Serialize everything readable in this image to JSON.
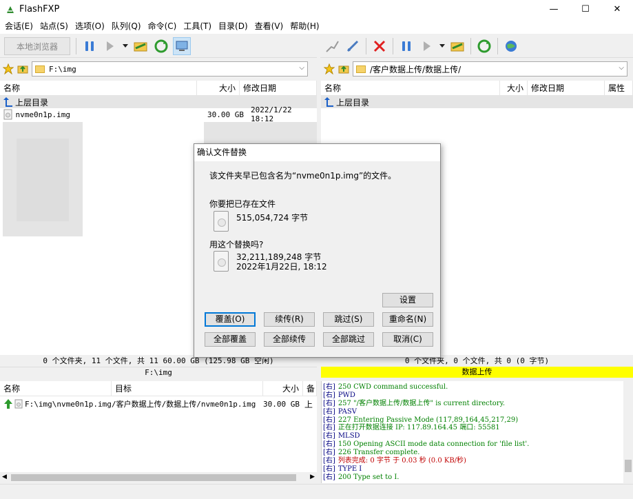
{
  "window": {
    "title": "FlashFXP",
    "minimize": "—",
    "maximize": "☐",
    "close": "✕"
  },
  "menu": [
    "会话(E)",
    "站点(S)",
    "选项(O)",
    "队列(Q)",
    "命令(C)",
    "工具(T)",
    "目录(D)",
    "查看(V)",
    "帮助(H)"
  ],
  "left_toolbar": {
    "local_browse": "本地浏览器"
  },
  "left_address": {
    "path": "F:\\img"
  },
  "right_address": {
    "path": "/客户数据上传/数据上传/"
  },
  "left_pane": {
    "columns": {
      "name": "名称",
      "size": "大小",
      "modified": "修改日期"
    },
    "parent": "上层目录",
    "files": [
      {
        "name": "nvme0n1p.img",
        "size": "30.00 GB",
        "date": "2022/1/22 18:12"
      }
    ]
  },
  "right_pane": {
    "columns": {
      "name": "名称",
      "size": "大小",
      "modified": "修改日期",
      "attr": "属性"
    },
    "parent": "上层目录"
  },
  "left_status": {
    "summary": "0 个文件夹, 11 个文件, 共 11 60.00 GB (125.98 GB 空闲)",
    "path": "F:\\img"
  },
  "right_status": {
    "summary": "0 个文件夹, 0 个文件, 共 0 (0 字节)",
    "path": "数据上传"
  },
  "queue": {
    "columns": {
      "name": "名称",
      "target": "目标",
      "size": "大小",
      "note": "备"
    },
    "items": [
      {
        "name": "F:\\img\\nvme0n1p.img",
        "target": "/客户数据上传/数据上传/nvme0n1p.img",
        "size": "30.00 GB",
        "note": "上"
      }
    ]
  },
  "log": [
    {
      "tag": "[右]",
      "text": "250 CWD command successful.",
      "color": "green"
    },
    {
      "tag": "[右]",
      "text": "PWD",
      "color": "blue"
    },
    {
      "tag": "[右]",
      "text": "257 \"/客户数据上传/数据上传\" is current directory.",
      "color": "green"
    },
    {
      "tag": "[右]",
      "text": "PASV",
      "color": "blue"
    },
    {
      "tag": "[右]",
      "text": "227 Entering Passive Mode (117,89,164,45,217,29)",
      "color": "green"
    },
    {
      "tag": "[右]",
      "text": "正在打开数据连接 IP: 117.89.164.45 端口: 55581",
      "color": "green"
    },
    {
      "tag": "[右]",
      "text": "MLSD",
      "color": "blue"
    },
    {
      "tag": "[右]",
      "text": "150 Opening ASCII mode data connection for 'file list'.",
      "color": "green"
    },
    {
      "tag": "[右]",
      "text": "226 Transfer complete.",
      "color": "green"
    },
    {
      "tag": "[右]",
      "text": "列表完成: 0 字节 于 0.03 秒 (0.0 KB/秒)",
      "color": "red"
    },
    {
      "tag": "[右]",
      "text": "TYPE I",
      "color": "blue"
    },
    {
      "tag": "[右]",
      "text": "200 Type set to I.",
      "color": "green"
    }
  ],
  "dialog": {
    "title": "确认文件替换",
    "message": "该文件夹早已包含名为“nvme0n1p.img”的文件。",
    "existing_label": "你要把已存在文件",
    "existing_size": "515,054,724 字节",
    "replace_label": "用这个替换吗?",
    "new_size": "32,211,189,248 字节",
    "new_date": "2022年1月22日, 18:12",
    "buttons": {
      "settings": "设置",
      "overwrite": "覆盖(O)",
      "resume": "续传(R)",
      "skip": "跳过(S)",
      "rename": "重命名(N)",
      "overwrite_all": "全部覆盖",
      "resume_all": "全部续传",
      "skip_all": "全部跳过",
      "cancel": "取消(C)"
    }
  },
  "colors": {
    "accent_yellow": "#ffff00",
    "select_blue": "#0078d7"
  }
}
